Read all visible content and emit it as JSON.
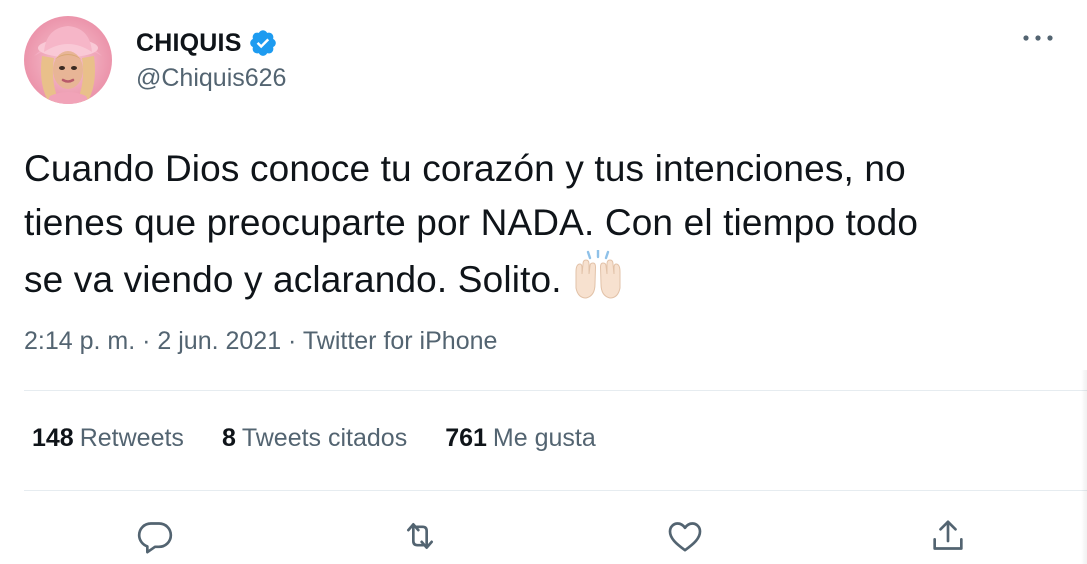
{
  "author": {
    "display_name": "CHIQUIS",
    "handle": "@Chiquis626",
    "verified_icon": "verified-badge-icon",
    "avatar_icon": "avatar"
  },
  "tweet": {
    "line1": "Cuando Dios conoce tu corazón y tus intenciones, no",
    "line2": "tienes que preocuparte por NADA. Con el tiempo todo",
    "line3": "se va viendo y aclarando. Solito.",
    "emoji": "raising-hands-emoji"
  },
  "meta": {
    "time": "2:14 p. m.",
    "sep1": " · ",
    "date": "2 jun. 2021",
    "sep2": " · ",
    "source": "Twitter for iPhone"
  },
  "stats": {
    "retweets_count": "148",
    "retweets_label": "Retweets",
    "quotes_count": "8",
    "quotes_label": "Tweets citados",
    "likes_count": "761",
    "likes_label": "Me gusta"
  },
  "actions": {
    "reply": "reply-icon",
    "retweet": "retweet-icon",
    "like": "heart-icon",
    "share": "share-icon"
  },
  "colors": {
    "text": "#0f1419",
    "secondary": "#536471",
    "verified": "#1d9bf0",
    "divider": "#e6ecf0"
  }
}
